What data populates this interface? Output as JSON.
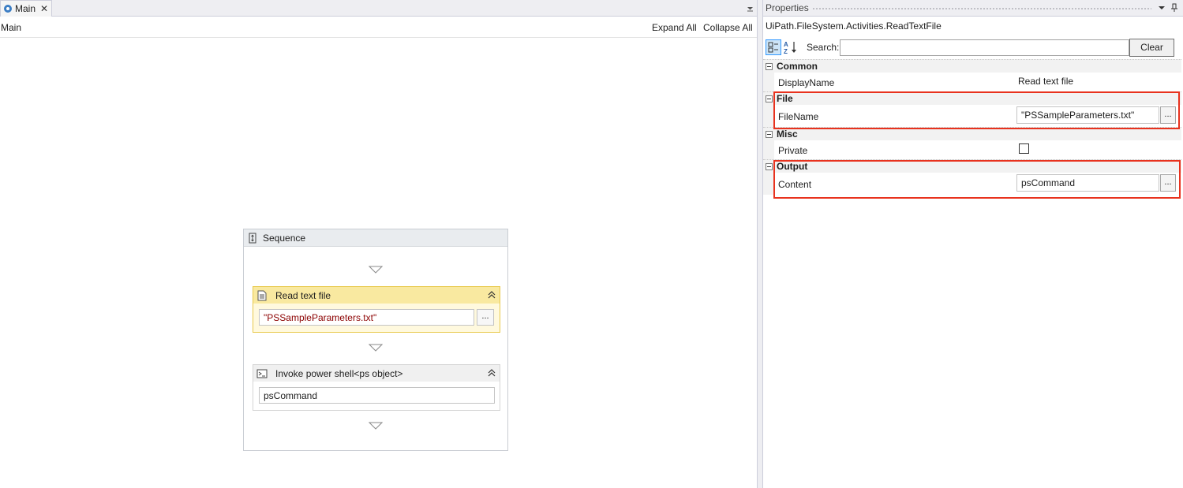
{
  "designer": {
    "tab_label": "Main",
    "breadcrumb": "Main",
    "expand_all": "Expand All",
    "collapse_all": "Collapse All",
    "sequence": {
      "title": "Sequence",
      "activities": [
        {
          "title": "Read text file",
          "value": "\"PSSampleParameters.txt\"",
          "button": "..."
        },
        {
          "title": "Invoke power shell<ps object>",
          "value": "psCommand"
        }
      ]
    }
  },
  "properties": {
    "title": "Properties",
    "type_name": "UiPath.FileSystem.Activities.ReadTextFile",
    "search_label": "Search:",
    "search_value": "",
    "clear_label": "Clear",
    "categories": {
      "common": {
        "label": "Common",
        "props": [
          {
            "name": "DisplayName",
            "value": "Read text file"
          }
        ]
      },
      "file": {
        "label": "File",
        "props": [
          {
            "name": "FileName",
            "value": "\"PSSampleParameters.txt\"",
            "button": "..."
          }
        ]
      },
      "misc": {
        "label": "Misc",
        "props": [
          {
            "name": "Private",
            "checked": false
          }
        ]
      },
      "output": {
        "label": "Output",
        "props": [
          {
            "name": "Content",
            "value": "psCommand",
            "button": "..."
          }
        ]
      }
    }
  },
  "colors": {
    "selected_activity_header": "#f9e9a0",
    "highlight_box": "#e8321e",
    "string_literal": "#8b0000"
  },
  "icons": [
    "workflow-tab-icon",
    "close-icon",
    "chevron-down-icon",
    "sequence-icon",
    "document-icon",
    "powershell-icon",
    "collapse-icon",
    "categorized-icon",
    "sort-alpha-icon",
    "pin-icon"
  ]
}
